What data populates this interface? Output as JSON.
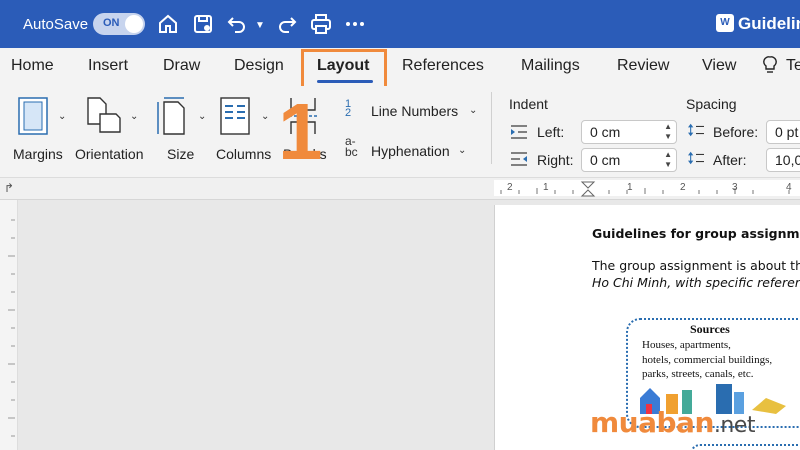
{
  "titlebar": {
    "autosave_label": "AutoSave",
    "autosave_state": "ON",
    "doc_title": "Guidelin",
    "app_badge": "W",
    "icons": [
      "home-icon",
      "save-icon",
      "undo-icon",
      "redo-icon",
      "print-icon",
      "more-icon"
    ]
  },
  "tabs": [
    {
      "label": "Home"
    },
    {
      "label": "Insert"
    },
    {
      "label": "Draw"
    },
    {
      "label": "Design"
    },
    {
      "label": "Layout",
      "active": true
    },
    {
      "label": "References"
    },
    {
      "label": "Mailings"
    },
    {
      "label": "Review"
    },
    {
      "label": "View"
    },
    {
      "label": "Te"
    }
  ],
  "ribbon": {
    "margins": "Margins",
    "orientation": "Orientation",
    "size": "Size",
    "columns": "Columns",
    "breaks": "Breaks",
    "line_numbers": "Line Numbers",
    "hyphenation": "Hyphenation",
    "indent": {
      "title": "Indent",
      "left_label": "Left:",
      "left_value": "0 cm",
      "right_label": "Right:",
      "right_value": "0 cm"
    },
    "spacing": {
      "title": "Spacing",
      "before_label": "Before:",
      "before_value": "0 pt",
      "after_label": "After:",
      "after_value": "10,0"
    }
  },
  "annotation": {
    "step_number": "1",
    "accent_color": "#f08a3c"
  },
  "ruler": {
    "numbers": [
      "2",
      "1",
      "1",
      "2",
      "3",
      "4"
    ]
  },
  "document": {
    "heading": "Guidelines for group assignment:",
    "line1": "The group assignment is about the",
    "line2": "Ho Chi Minh, with specific referen",
    "sources": {
      "title": "Sources",
      "line1": "Houses, apartments,",
      "line2": "hotels, commercial buildings,",
      "line3": "parks, streets, canals, etc."
    }
  },
  "watermark": {
    "brand": "muaban",
    "suffix": ".net"
  },
  "colors": {
    "titlebar": "#2b5cb8",
    "ribbon": "#f3f3f3",
    "highlight": "#f08a3c"
  }
}
